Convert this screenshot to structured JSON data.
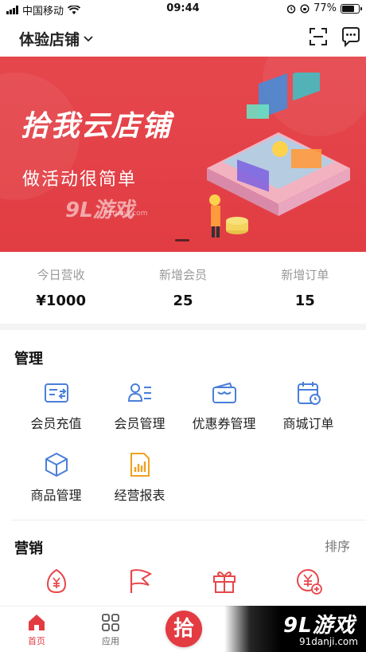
{
  "status_bar": {
    "carrier": "中国移动",
    "time": "09:44",
    "battery": "77%",
    "battery_level": 0.77
  },
  "header": {
    "store_name": "体验店铺",
    "scan_icon": "scan-icon",
    "message_icon": "message-icon"
  },
  "banner": {
    "title": "拾我云店铺",
    "subtitle": "做活动很简单",
    "watermark_logo": "9L游戏",
    "watermark_site": "91danji.com"
  },
  "stats": [
    {
      "label": "今日营收",
      "value": "¥1000"
    },
    {
      "label": "新增会员",
      "value": "25"
    },
    {
      "label": "新增订单",
      "value": "15"
    }
  ],
  "management": {
    "title": "管理",
    "items": [
      {
        "label": "会员充值",
        "icon": "recharge-card-icon"
      },
      {
        "label": "会员管理",
        "icon": "member-card-icon"
      },
      {
        "label": "优惠券管理",
        "icon": "coupon-wallet-icon"
      },
      {
        "label": "商城订单",
        "icon": "calendar-clock-icon"
      },
      {
        "label": "商品管理",
        "icon": "box-icon"
      },
      {
        "label": "经营报表",
        "icon": "report-chart-icon"
      }
    ]
  },
  "marketing": {
    "title": "营销",
    "sort_label": "排序",
    "items": [
      {
        "icon": "yuan-egg-icon"
      },
      {
        "icon": "flag-icon"
      },
      {
        "icon": "gift-icon"
      },
      {
        "icon": "yuan-plus-icon"
      }
    ]
  },
  "tabbar": {
    "tabs": [
      {
        "label": "首页",
        "icon": "home-icon"
      },
      {
        "label": "应用",
        "icon": "apps-grid-icon"
      }
    ],
    "center_label": "拾"
  },
  "watermark": {
    "logo": "9L游戏",
    "site": "91danji.com"
  },
  "colors": {
    "brand_red": "#e33b41",
    "icon_blue": "#4a7fd9",
    "icon_orange": "#f0a020",
    "icon_red": "#e8464c"
  }
}
